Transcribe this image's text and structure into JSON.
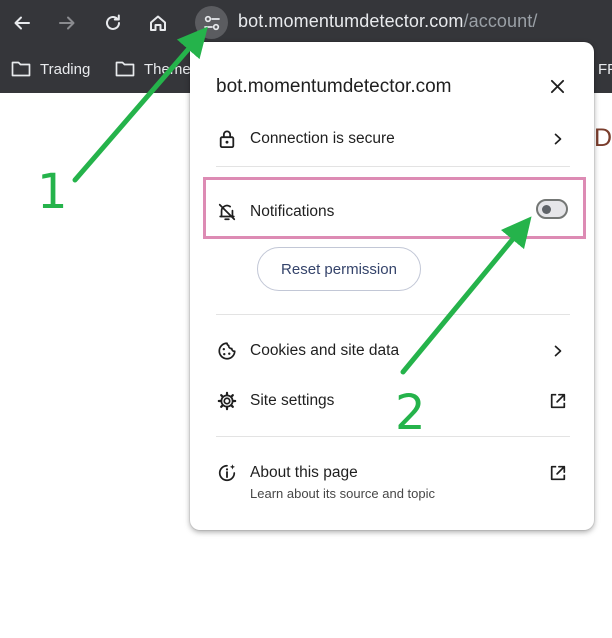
{
  "browser": {
    "url_host": "bot.momentumdetector.com",
    "url_path": "/account/",
    "bookmarks": [
      {
        "label": "Trading"
      },
      {
        "label": "Theme"
      },
      {
        "label": "FF"
      }
    ],
    "page_partial_text": "D"
  },
  "popup": {
    "title": "bot.momentumdetector.com",
    "connection": {
      "label": "Connection is secure",
      "icon": "lock-icon"
    },
    "notifications": {
      "label": "Notifications",
      "icon": "bell-off-icon",
      "enabled": false
    },
    "reset_button": "Reset permission",
    "cookies": {
      "label": "Cookies and site data",
      "icon": "cookie-icon"
    },
    "site_settings": {
      "label": "Site settings",
      "icon": "gear-icon"
    },
    "about": {
      "label": "About this page",
      "sublabel": "Learn about its source and topic",
      "icon": "info-sparkle-icon"
    }
  },
  "annotations": {
    "step1": "1",
    "step2": "2",
    "arrow_color": "#25b34b",
    "highlight_color": "#dd8bb4"
  },
  "colors": {
    "chrome_bg": "#35363a",
    "popup_bg": "#ffffff"
  }
}
